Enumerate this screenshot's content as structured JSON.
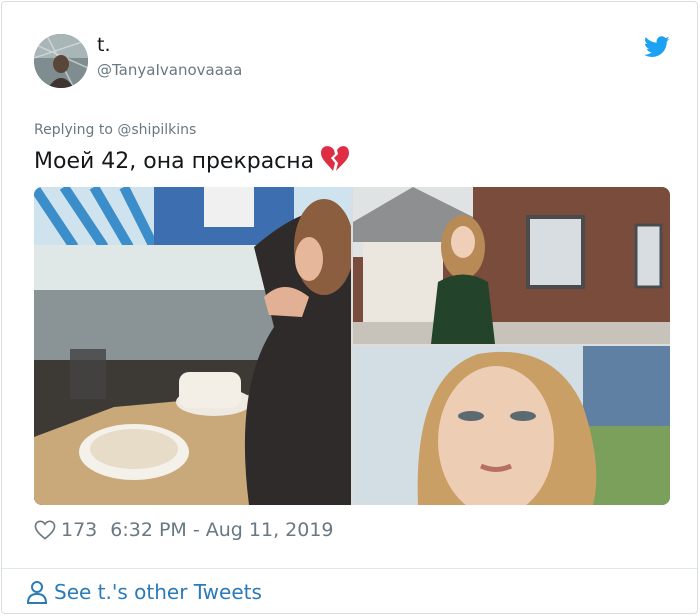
{
  "user": {
    "display_name": "t.",
    "handle": "@TanyaIvanovaaaa"
  },
  "tweet": {
    "replying_prefix": "Replying to ",
    "replying_to": "@shipilkins",
    "text": "Моей 42, она прекрасна",
    "emoji": "broken-heart-icon",
    "like_count": "173",
    "timestamp": "6:32 PM - Aug 11, 2019"
  },
  "footer": {
    "see_more": "See t.'s other Tweets"
  },
  "colors": {
    "brand": "#1da1f2",
    "link": "#2b7bb9",
    "text": "#14171a",
    "muted": "#697882",
    "heart": "#dd2e44"
  }
}
